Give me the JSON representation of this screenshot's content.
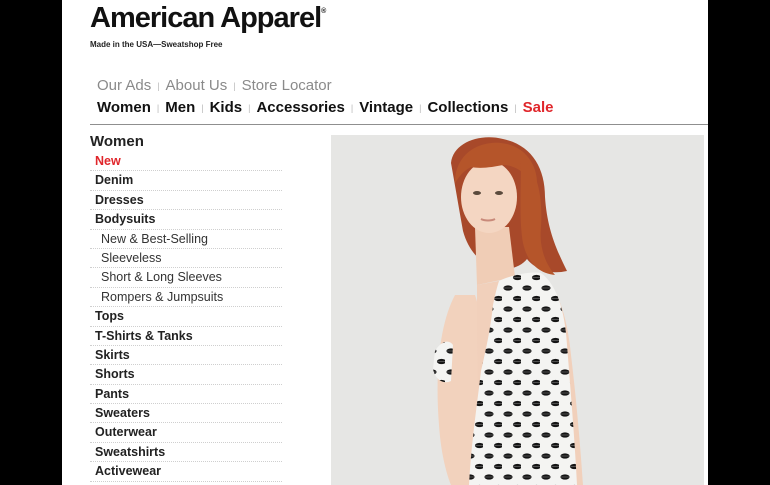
{
  "header": {
    "logo": "American Apparel",
    "logo_mark": "®",
    "tagline": "Made in the USA—Sweatshop Free"
  },
  "topnav": {
    "items": [
      "Our Ads",
      "About Us",
      "Store Locator"
    ]
  },
  "mainnav": {
    "items": [
      "Women",
      "Men",
      "Kids",
      "Accessories",
      "Vintage",
      "Collections"
    ],
    "sale": "Sale"
  },
  "sidebar": {
    "heading": "Women",
    "items": [
      "New",
      "Denim",
      "Dresses",
      "Bodysuits",
      "New & Best-Selling",
      "Sleeveless",
      "Short & Long Sleeves",
      "Rompers & Jumpsuits",
      "Tops",
      "T-Shirts & Tanks",
      "Skirts",
      "Shorts",
      "Pants",
      "Sweaters",
      "Outerwear",
      "Sweatshirts",
      "Activewear"
    ]
  },
  "colors": {
    "sale": "#e0262b",
    "new": "#e0262b",
    "photo_background": "#e6e6e4",
    "hair": "#b5552a"
  }
}
